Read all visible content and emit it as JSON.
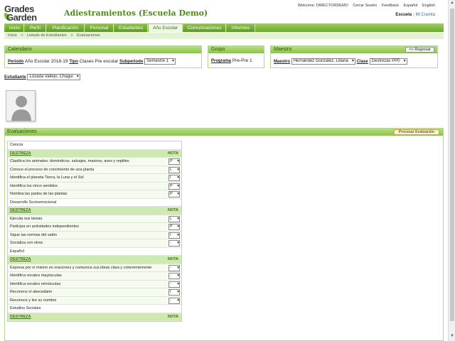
{
  "header": {
    "logo_line1": "Grades",
    "logo_line2": "Garden",
    "title": "Adiestramientos (Escuela Demo)",
    "top_links": [
      "Welcome: DIRECTORDEMO",
      "Cerrar Sesión",
      "Feedback",
      "Español",
      "English"
    ],
    "school_label": "Escuela",
    "account_link": "Mi Cuenta"
  },
  "nav": {
    "tabs": [
      "Inicio",
      "Perfil",
      "Planificación",
      "Personal",
      "Estudiantes",
      "Año Escolar",
      "Comunicaciones",
      "Informes"
    ],
    "active": "Año Escolar"
  },
  "breadcrumb": [
    "Inicio",
    ">",
    "Listado de Estudiantes",
    ">",
    "Evaluaciones"
  ],
  "calendario": {
    "title": "Calendario",
    "periodo_label": "Periodo",
    "periodo_value": "Año Escolar 2018-19",
    "tipo_label": "Tipo",
    "tipo_value": "Clases Pre escolar",
    "subperiodo_label": "Subperiodo",
    "subperiodo_value": "Semestre 1"
  },
  "grupo": {
    "title": "Grupo",
    "programa_label": "Programa",
    "programa_value": "Pre-Pre  1"
  },
  "maestro": {
    "title": "Maestro",
    "back_label": "<< Regresar",
    "maestro_label": "Maestro",
    "maestro_value": "Hernández González, Liliana",
    "clase_label": "Clase",
    "clase_value": "Destrezas PP0"
  },
  "student": {
    "label": "Estudiante",
    "value": "Lozada Vallejo, Chagui"
  },
  "evaluaciones": {
    "title": "Evaluaciones",
    "process_label": "Procesar Evaluación",
    "col_destreza": "DESTREZA",
    "col_nota": "NOTA",
    "sections": [
      {
        "name": "Ciencia",
        "items": [
          {
            "text": "Clasifica los animales: domésticos, salvajes, marinos, aves y reptiles",
            "grade": "P"
          },
          {
            "text": "Conoce el proceso de crecimiento de una planta",
            "grade": "L"
          },
          {
            "text": "Identifica el planeta Tierra, la Luna y el Sol",
            "grade": "I"
          },
          {
            "text": "Identifica los cinco sentidos",
            "grade": "P"
          },
          {
            "text": "Nombra las partes de las plantas",
            "grade": "P"
          }
        ]
      },
      {
        "name": "Desarrollo Socioemocional",
        "items": [
          {
            "text": "Ejecuta sus tareas",
            "grade": "L"
          },
          {
            "text": "Participa en actividades independientes",
            "grade": "P"
          },
          {
            "text": "Sigue las normas del salón",
            "grade": "I"
          },
          {
            "text": "Socializa con otros",
            "grade": "-"
          }
        ]
      },
      {
        "name": "Español",
        "items": [
          {
            "text": "Expresa por sí mismo en oraciones y comunica sus ideas clara y coherentemente",
            "grade": "-"
          },
          {
            "text": "Identifica vocales mayúsculas",
            "grade": "-"
          },
          {
            "text": "Identifica vocales minúsculas",
            "grade": "-"
          },
          {
            "text": "Reconoce el abecedario",
            "grade": "I"
          },
          {
            "text": "Reconoce y lee su nombre",
            "grade": "-"
          }
        ]
      },
      {
        "name": "Estudios Sociales",
        "items": []
      }
    ]
  }
}
